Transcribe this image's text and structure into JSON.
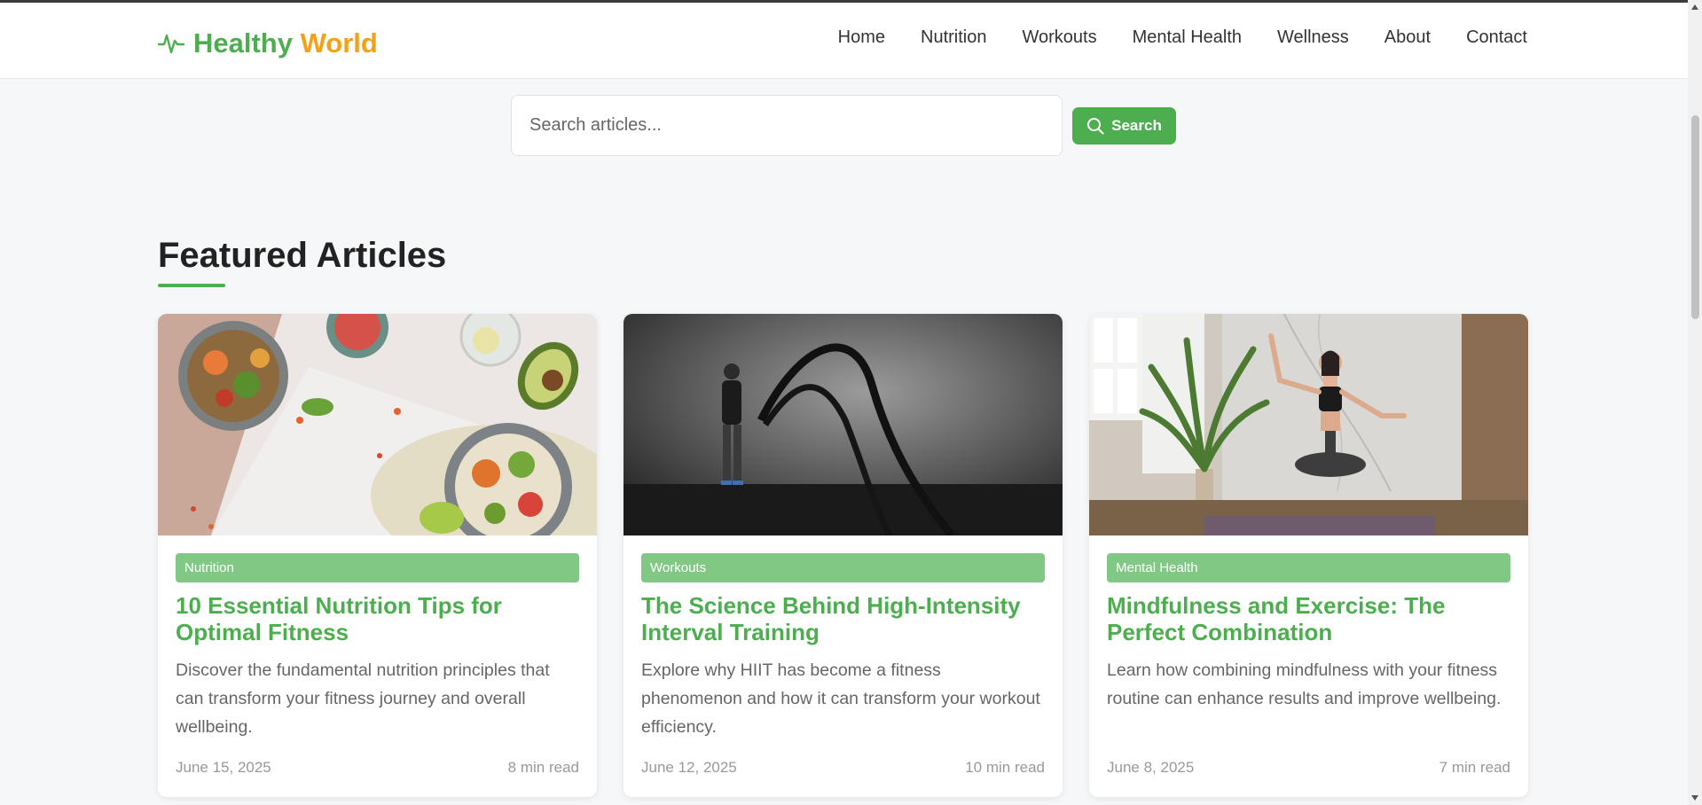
{
  "brand": {
    "word1": "Healthy",
    "word2": "World",
    "icon": "heartbeat-icon",
    "color1": "#4cae4f",
    "color2": "#f3a119"
  },
  "nav": {
    "items": [
      {
        "label": "Home"
      },
      {
        "label": "Nutrition"
      },
      {
        "label": "Workouts"
      },
      {
        "label": "Mental Health"
      },
      {
        "label": "Wellness"
      },
      {
        "label": "About"
      },
      {
        "label": "Contact"
      }
    ]
  },
  "search": {
    "placeholder": "Search articles...",
    "button_label": "Search",
    "icon": "search-icon"
  },
  "featured": {
    "title": "Featured Articles",
    "articles": [
      {
        "category": "Nutrition",
        "title": "10 Essential Nutrition Tips for Optimal Fitness",
        "description": "Discover the fundamental nutrition principles that can transform your fitness journey and overall wellbeing.",
        "date": "June 15, 2025",
        "read_time": "8 min read"
      },
      {
        "category": "Workouts",
        "title": "The Science Behind High-Intensity Interval Training",
        "description": "Explore why HIIT has become a fitness phenomenon and how it can transform your workout efficiency.",
        "date": "June 12, 2025",
        "read_time": "10 min read"
      },
      {
        "category": "Mental Health",
        "title": "Mindfulness and Exercise: The Perfect Combination",
        "description": "Learn how combining mindfulness with your fitness routine can enhance results and improve wellbeing.",
        "date": "June 8, 2025",
        "read_time": "7 min read"
      }
    ]
  },
  "colors": {
    "accent": "#4cae4f",
    "badge": "#80c883",
    "brand_orange": "#f3a119"
  }
}
